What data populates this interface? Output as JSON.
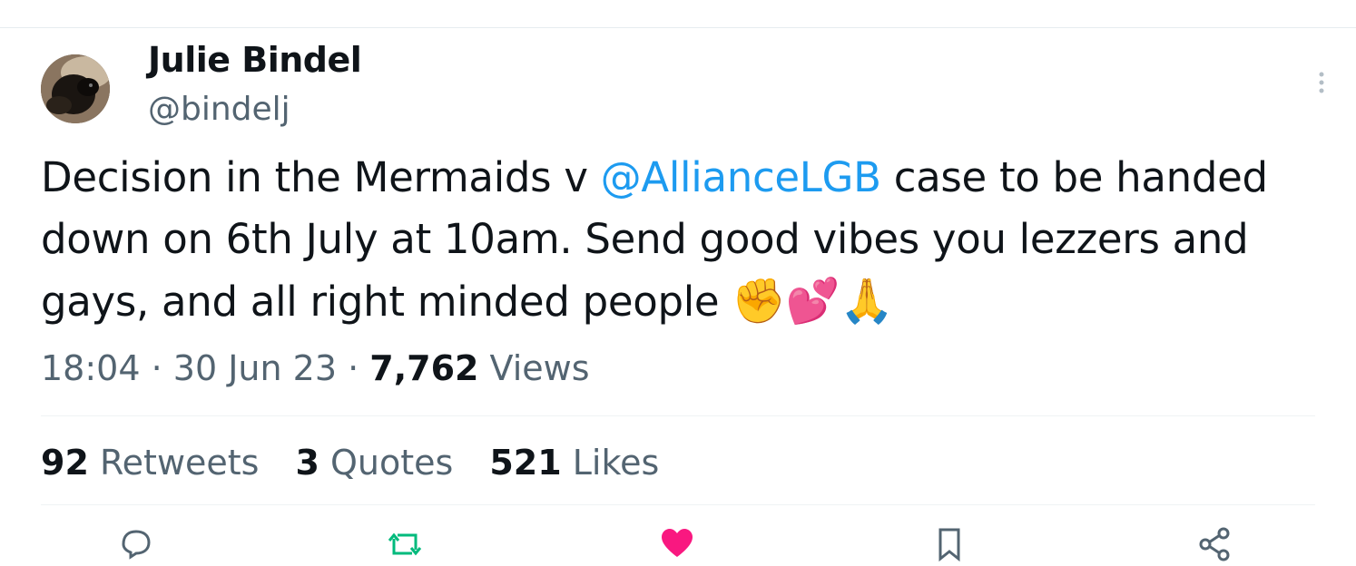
{
  "author": {
    "name": "Julie Bindel",
    "handle": "@bindelj"
  },
  "tweet": {
    "text_before": "Decision in the Mermaids v ",
    "mention": "@AllianceLGB",
    "text_after": " case to be handed down on 6th July at 10am. Send good vibes you lezzers and gays, and all right minded people ",
    "emojis": "✊💕🙏"
  },
  "meta": {
    "time": "18:04",
    "separator": " · ",
    "date": "30 Jun 23",
    "views_count": "7,762",
    "views_label": " Views"
  },
  "stats": {
    "retweets_count": "92",
    "retweets_label": " Retweets",
    "quotes_count": "3",
    "quotes_label": " Quotes",
    "likes_count": "521",
    "likes_label": " Likes"
  },
  "actions": [
    "reply-icon",
    "retweet-icon",
    "like-icon",
    "bookmark-icon",
    "share-icon"
  ],
  "colors": {
    "accent": "#1d9bf0",
    "secondary_text": "#536471",
    "like": "#f91880",
    "retweet": "#00ba7c"
  }
}
